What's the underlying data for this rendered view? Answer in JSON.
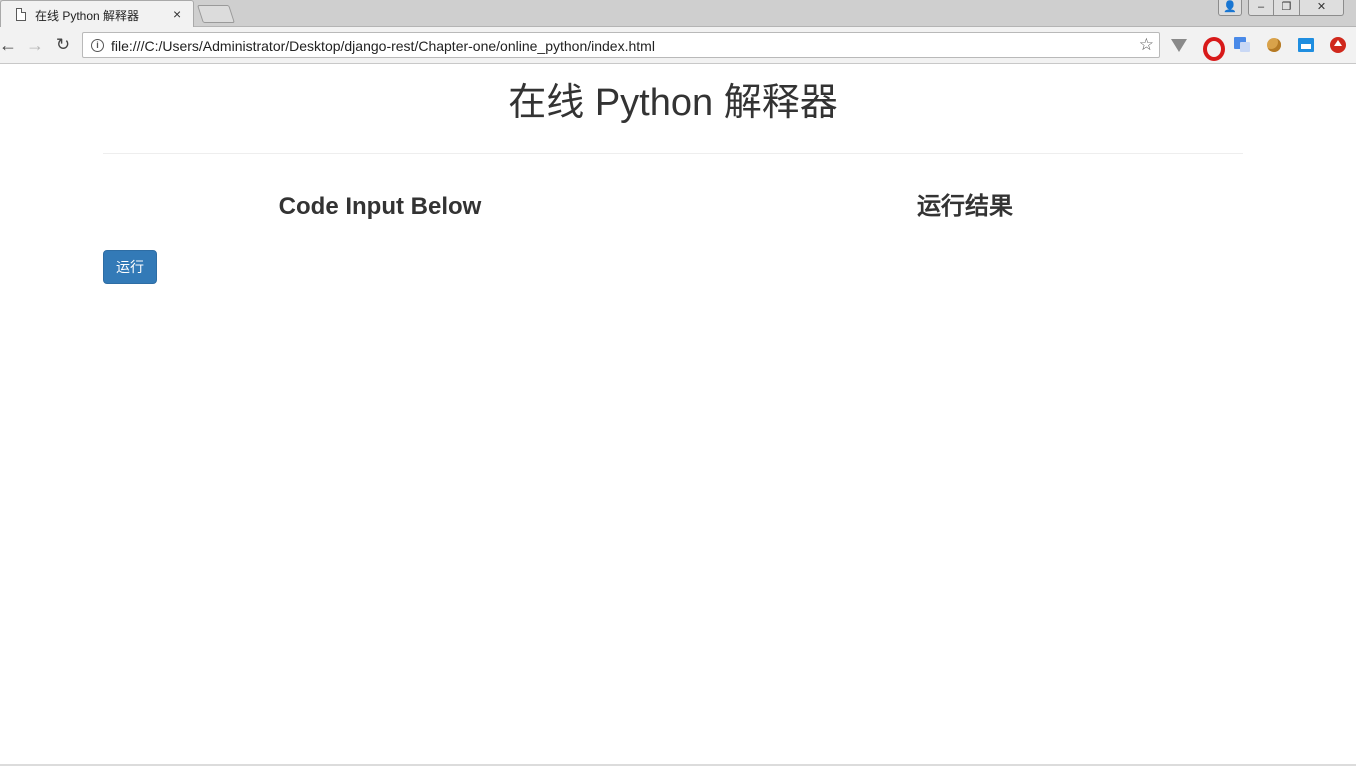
{
  "browser": {
    "tab_title": "在线 Python 解释器",
    "tab_close": "×",
    "url": "file:///C:/Users/Administrator/Desktop/django-rest/Chapter-one/online_python/index.html",
    "window_buttons": {
      "minimize": "–",
      "maximize": "❐",
      "close": "✕",
      "user": "👤"
    },
    "nav": {
      "back": "←",
      "forward": "→",
      "reload": "↻"
    },
    "info": "i",
    "star": "☆",
    "extensions": [
      "vpn-icon",
      "opera-icon",
      "google-translate-icon",
      "cookie-icon",
      "window-icon",
      "upload-icon"
    ]
  },
  "page": {
    "title": "在线 Python 解释器",
    "code_heading": "Code Input Below",
    "result_heading": "运行结果",
    "run_button": "运行"
  },
  "colors": {
    "primary_button": "#337ab7",
    "text": "#333333"
  }
}
